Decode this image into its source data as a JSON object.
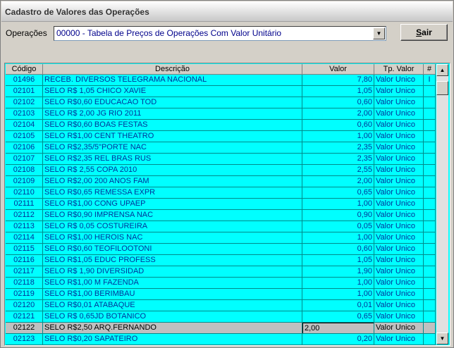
{
  "window": {
    "title": "Cadastro de Valores das Operações"
  },
  "filter": {
    "label": "Operações",
    "selected": "00000 - Tabela de Preços de Operações Com Valor Unitário"
  },
  "exit_button": {
    "label_prefix": "",
    "label_underlined": "S",
    "label_rest": "air"
  },
  "grid": {
    "columns": [
      "Código",
      "Descrição",
      "Valor",
      "Tp. Valor",
      "#"
    ],
    "rows": [
      {
        "code": "01496",
        "desc": "RECEB. DIVERSOS TELEGRAMA NACIONAL",
        "value": "7,80",
        "type": "Valor Unico",
        "flag": "I"
      },
      {
        "code": "02101",
        "desc": "SELO R$ 1,05 CHICO XAVIE",
        "value": "1,05",
        "type": "Valor Unico",
        "flag": ""
      },
      {
        "code": "02102",
        "desc": "SELO R$0,60 EDUCACAO TOD",
        "value": "0,60",
        "type": "Valor Unico",
        "flag": ""
      },
      {
        "code": "02103",
        "desc": "SELO R$ 2,00 JG RIO 2011",
        "value": "2,00",
        "type": "Valor Unico",
        "flag": ""
      },
      {
        "code": "02104",
        "desc": "SELO R$0,60 BOAS FESTAS",
        "value": "0,60",
        "type": "Valor Unico",
        "flag": ""
      },
      {
        "code": "02105",
        "desc": "SELO R$1,00 CENT THEATRO",
        "value": "1,00",
        "type": "Valor Unico",
        "flag": ""
      },
      {
        "code": "02106",
        "desc": "SELO R$2,35/5\"PORTE NAC",
        "value": "2,35",
        "type": "Valor Unico",
        "flag": ""
      },
      {
        "code": "02107",
        "desc": "SELO R$2,35 REL BRAS RUS",
        "value": "2,35",
        "type": "Valor Unico",
        "flag": ""
      },
      {
        "code": "02108",
        "desc": "SELO R$ 2,55 COPA 2010",
        "value": "2,55",
        "type": "Valor Unico",
        "flag": ""
      },
      {
        "code": "02109",
        "desc": "SELO R$2,00 200 ANOS FAM",
        "value": "2,00",
        "type": "Valor Unico",
        "flag": ""
      },
      {
        "code": "02110",
        "desc": "SELO R$0,65 REMESSA EXPR",
        "value": "0,65",
        "type": "Valor Unico",
        "flag": ""
      },
      {
        "code": "02111",
        "desc": "SELO R$1,00 CONG UPAEP",
        "value": "1,00",
        "type": "Valor Unico",
        "flag": ""
      },
      {
        "code": "02112",
        "desc": "SELO R$0,90 IMPRENSA NAC",
        "value": "0,90",
        "type": "Valor Unico",
        "flag": ""
      },
      {
        "code": "02113",
        "desc": "SELO R$ 0,05 COSTUREIRA",
        "value": "0,05",
        "type": "Valor Unico",
        "flag": ""
      },
      {
        "code": "02114",
        "desc": "SELO R$1,00 HEROIS NAC",
        "value": "1,00",
        "type": "Valor Unico",
        "flag": ""
      },
      {
        "code": "02115",
        "desc": "SELO R$0,60 TEOFILOOTONI",
        "value": "0,60",
        "type": "Valor Unico",
        "flag": ""
      },
      {
        "code": "02116",
        "desc": "SELO R$1,05 EDUC PROFESS",
        "value": "1,05",
        "type": "Valor Unico",
        "flag": ""
      },
      {
        "code": "02117",
        "desc": "SELO R$ 1,90 DIVERSIDAD",
        "value": "1,90",
        "type": "Valor Unico",
        "flag": ""
      },
      {
        "code": "02118",
        "desc": "SELO R$1,00 M FAZENDA",
        "value": "1,00",
        "type": "Valor Unico",
        "flag": ""
      },
      {
        "code": "02119",
        "desc": "SELO R$1,00 BERIMBAU",
        "value": "1,00",
        "type": "Valor Unico",
        "flag": ""
      },
      {
        "code": "02120",
        "desc": "SELO R$0,01 ATABAQUE",
        "value": "0,01",
        "type": "Valor Unico",
        "flag": ""
      },
      {
        "code": "02121",
        "desc": "SELO R$ 0,65JD BOTANICO",
        "value": "0,65",
        "type": "Valor Unico",
        "flag": ""
      },
      {
        "code": "02122",
        "desc": "SELO R$2,50 ARQ.FERNANDO",
        "value": "2,00",
        "type": "Valor Unico",
        "flag": "",
        "selected": true
      },
      {
        "code": "02123",
        "desc": "SELO R$0,20 SAPATEIRO",
        "value": "0,20",
        "type": "Valor Unico",
        "flag": ""
      }
    ]
  },
  "scrollbar": {
    "up_icon": "arrow-up-icon",
    "down_icon": "arrow-down-icon"
  }
}
